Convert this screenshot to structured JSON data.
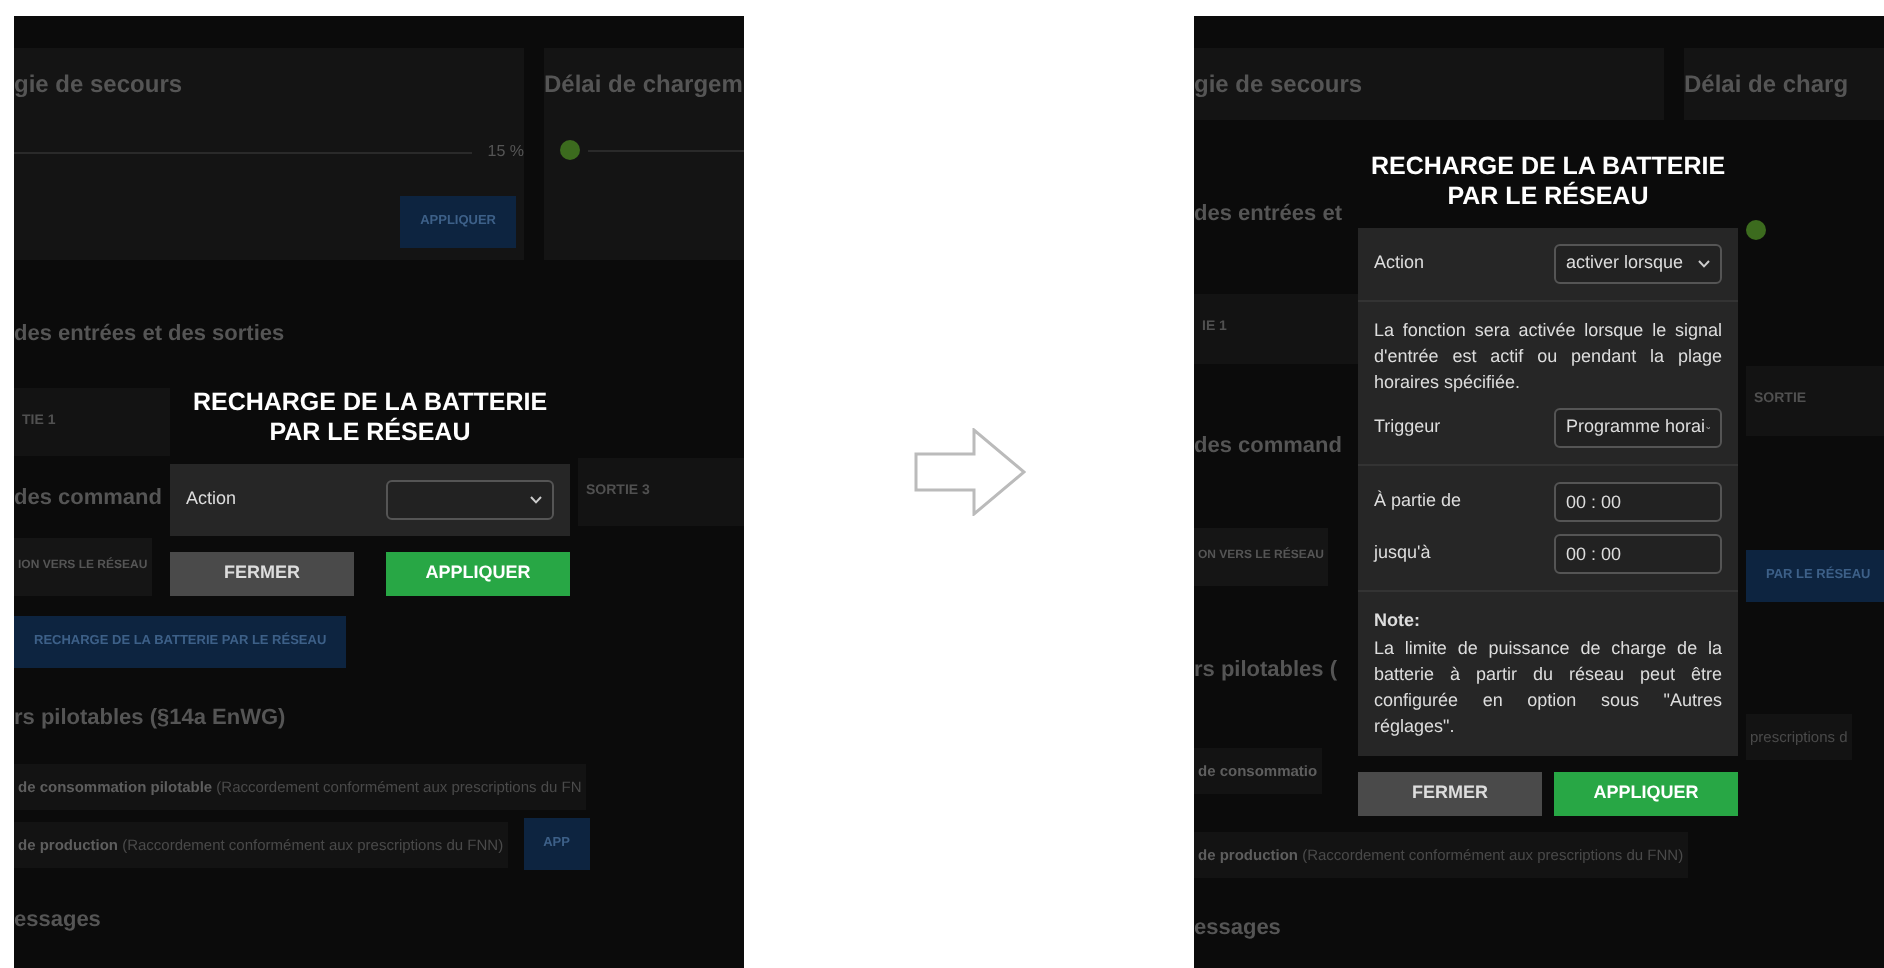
{
  "panels": [
    {
      "cards": [
        {
          "kind": "reading",
          "title": "gie de secours",
          "reading": "15 %",
          "button": "APPLIQUER"
        },
        {
          "kind": "dot",
          "title": "Délai de chargem"
        }
      ],
      "above": [
        {
          "kind": "heading",
          "text": "des entrées et des sorties"
        }
      ],
      "left": [
        {
          "kind": "cell",
          "text": "TIE 1"
        },
        {
          "kind": "heading",
          "text": "des command"
        },
        {
          "kind": "dark_button",
          "text": "ION VERS LE RÉSEAU"
        }
      ],
      "right": [
        {
          "kind": "cell",
          "text": "SORTIE 3"
        }
      ],
      "modal": {
        "title": "RECHARGE DE LA BATTERIE PAR LE RÉSEAU",
        "sections": [
          [
            {
              "kind": "select",
              "label": "Action"
            }
          ]
        ],
        "buttons": [
          {
            "kind": "close",
            "label": "FERMER"
          },
          {
            "kind": "apply",
            "label": "APPLIQUER"
          }
        ]
      },
      "below": [
        {
          "kind": "blue_button",
          "text": "RECHARGE DE LA BATTERIE PAR LE RÉSEAU"
        },
        {
          "kind": "heading",
          "text": "rs pilotables (§14a EnWG)"
        },
        {
          "kind": "row",
          "text": "**de consommation pilotable** (Raccordement conformément aux prescriptions du FN"
        },
        {
          "kind": "row",
          "text": "**de production** (Raccordement conformément aux prescriptions du FNN)",
          "button": "APP"
        },
        {
          "kind": "heading",
          "text": "essages"
        }
      ]
    },
    {
      "cards": [
        {
          "kind": "plain",
          "title": "gie de secours"
        },
        {
          "kind": "plain",
          "title": "Délai de charg"
        }
      ],
      "left": [
        {
          "kind": "heading",
          "text": "des entrées et"
        },
        {
          "kind": "cell",
          "text": "IE 1"
        },
        {
          "kind": "heading",
          "text": "des command"
        },
        {
          "kind": "dark_button",
          "text": "ON VERS LE RÉSEAU"
        },
        {
          "kind": "heading",
          "text": "rs pilotables ("
        },
        {
          "kind": "bold_row",
          "text": "de consommatio"
        }
      ],
      "right": [
        {
          "kind": "dot"
        },
        {
          "kind": "cell",
          "text": "SORTIE"
        },
        {
          "kind": "blue_button",
          "text": "PAR LE RÉSEAU"
        },
        {
          "kind": "row",
          "text": "prescriptions d"
        }
      ],
      "modal": {
        "title": "RECHARGE DE LA BATTERIE PAR LE RÉSEAU",
        "sections": [
          [
            {
              "kind": "select",
              "label": "Action",
              "value": "activer lorsque"
            }
          ],
          [
            {
              "kind": "text",
              "text": "La fonction sera activée lorsque le signal d'entrée est actif ou pendant la plage horaires spécifiée."
            },
            {
              "kind": "select",
              "label": "Triggeur",
              "value": "Programme horai"
            }
          ],
          [
            {
              "kind": "time",
              "label": "À partie de",
              "value": "00 : 00"
            },
            {
              "kind": "time",
              "label": "jusqu'à",
              "value": "00 : 00"
            }
          ],
          [
            {
              "kind": "note",
              "heading": "Note:",
              "text": "La limite de puissance de charge de la batterie à partir du réseau peut être configurée en option sous \"Autres réglages\"."
            }
          ]
        ],
        "buttons": [
          {
            "kind": "close",
            "label": "FERMER"
          },
          {
            "kind": "apply",
            "label": "APPLIQUER"
          }
        ]
      },
      "below": [
        {
          "kind": "row",
          "text": "**de production** (Raccordement conformément aux prescriptions du FNN)"
        },
        {
          "kind": "heading",
          "text": "essages"
        }
      ]
    }
  ]
}
